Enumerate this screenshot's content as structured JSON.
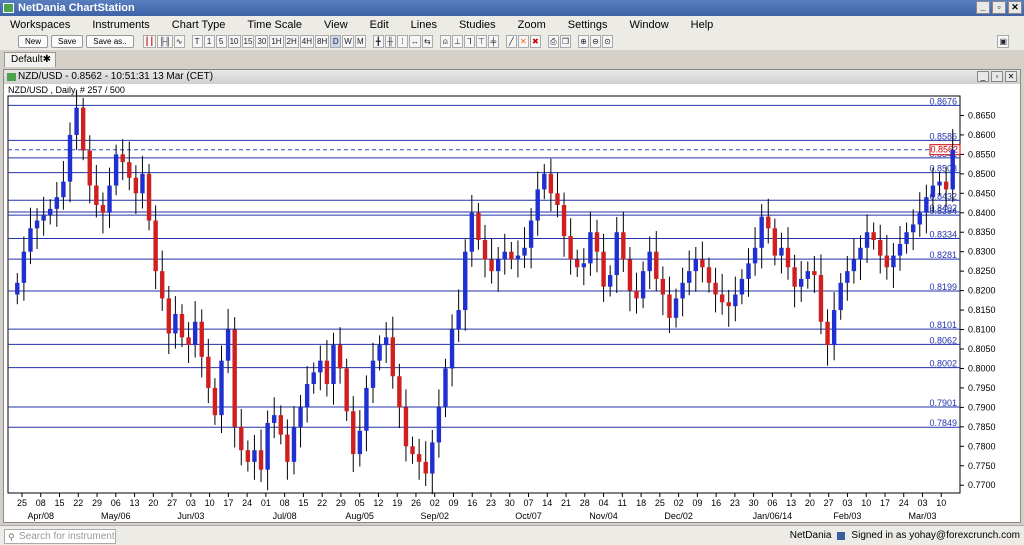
{
  "window": {
    "title": "NetDania ChartStation",
    "buttons": [
      "_",
      "▫",
      "✕"
    ]
  },
  "menu": [
    "Workspaces",
    "Instruments",
    "Chart Type",
    "Time Scale",
    "View",
    "Edit",
    "Lines",
    "Studies",
    "Zoom",
    "Settings",
    "Window",
    "Help"
  ],
  "toolbar": {
    "new": "New",
    "save": "Save",
    "save_as": "Save as..",
    "periods": [
      "T",
      "1",
      "5",
      "10",
      "15",
      "30",
      "1H",
      "2H",
      "4H",
      "8H",
      "D",
      "W",
      "M"
    ]
  },
  "tab": {
    "label": "Default",
    "close": "✱"
  },
  "chart_window": {
    "title": "NZD/USD - 0.8562 - 10:51:31  13 Mar (CET)",
    "subtitle": "NZD/USD , Daily, # 257 / 500"
  },
  "chart_data": {
    "type": "candlestick",
    "ylim": [
      0.768,
      0.87
    ],
    "y_ticks": [
      "0.8650",
      "0.8600",
      "0.8550",
      "0.8500",
      "0.8450",
      "0.8400",
      "0.8350",
      "0.8300",
      "0.8250",
      "0.8200",
      "0.8150",
      "0.8100",
      "0.8050",
      "0.8000",
      "0.7950",
      "0.7900",
      "0.7850",
      "0.7800",
      "0.7750",
      "0.7700"
    ],
    "x_ticks": [
      "25",
      "08",
      "15",
      "22",
      "29",
      "06",
      "13",
      "20",
      "27",
      "03",
      "10",
      "17",
      "24",
      "01",
      "08",
      "15",
      "22",
      "29",
      "05",
      "12",
      "19",
      "26",
      "02",
      "09",
      "16",
      "23",
      "30",
      "07",
      "14",
      "21",
      "28",
      "04",
      "11",
      "18",
      "25",
      "02",
      "09",
      "16",
      "23",
      "30",
      "06",
      "13",
      "20",
      "27",
      "03",
      "10",
      "17",
      "24",
      "03",
      "10"
    ],
    "month_labels": [
      {
        "label": "Apr/08",
        "at": 1
      },
      {
        "label": "May/06",
        "at": 5
      },
      {
        "label": "Jun/03",
        "at": 9
      },
      {
        "label": "Jul/08",
        "at": 14
      },
      {
        "label": "Aug/05",
        "at": 18
      },
      {
        "label": "Sep/02",
        "at": 22
      },
      {
        "label": "Oct/07",
        "at": 27
      },
      {
        "label": "Nov/04",
        "at": 31
      },
      {
        "label": "Dec/02",
        "at": 35
      },
      {
        "label": "Jan/06/14",
        "at": 40
      },
      {
        "label": "Feb/03",
        "at": 44
      },
      {
        "label": "Mar/03",
        "at": 48
      }
    ],
    "h_lines": [
      {
        "value": 0.8676,
        "label": "0.8676"
      },
      {
        "value": 0.8586,
        "label": "0.8586"
      },
      {
        "value": 0.8541,
        "label": "0.8541"
      },
      {
        "value": 0.8503,
        "label": "0.8503"
      },
      {
        "value": 0.8432,
        "label": "0.8432"
      },
      {
        "value": 0.8402,
        "label": "0.8402"
      },
      {
        "value": 0.8394,
        "label": "0.8394"
      },
      {
        "value": 0.8334,
        "label": "0.8334"
      },
      {
        "value": 0.8281,
        "label": "0.8281"
      },
      {
        "value": 0.8199,
        "label": "0.8199"
      },
      {
        "value": 0.8101,
        "label": "0.8101"
      },
      {
        "value": 0.8062,
        "label": "0.8062"
      },
      {
        "value": 0.8002,
        "label": "0.8002"
      },
      {
        "value": 0.7901,
        "label": "0.7901"
      },
      {
        "value": 0.7849,
        "label": "0.7849"
      }
    ],
    "current": {
      "value": 0.8562,
      "label": "0.8562"
    },
    "closes": [
      0.822,
      0.83,
      0.836,
      0.838,
      0.8395,
      0.841,
      0.844,
      0.848,
      0.86,
      0.867,
      0.856,
      0.847,
      0.842,
      0.84,
      0.847,
      0.855,
      0.853,
      0.849,
      0.845,
      0.85,
      0.838,
      0.825,
      0.818,
      0.809,
      0.814,
      0.808,
      0.806,
      0.812,
      0.803,
      0.795,
      0.788,
      0.802,
      0.81,
      0.785,
      0.779,
      0.776,
      0.779,
      0.774,
      0.786,
      0.788,
      0.783,
      0.776,
      0.785,
      0.79,
      0.796,
      0.799,
      0.802,
      0.796,
      0.806,
      0.8,
      0.789,
      0.778,
      0.784,
      0.795,
      0.802,
      0.806,
      0.808,
      0.798,
      0.79,
      0.78,
      0.778,
      0.776,
      0.773,
      0.781,
      0.79,
      0.8,
      0.81,
      0.815,
      0.83,
      0.84,
      0.833,
      0.828,
      0.825,
      0.828,
      0.83,
      0.828,
      0.829,
      0.831,
      0.838,
      0.846,
      0.85,
      0.845,
      0.842,
      0.834,
      0.828,
      0.826,
      0.827,
      0.835,
      0.83,
      0.821,
      0.824,
      0.835,
      0.828,
      0.82,
      0.818,
      0.825,
      0.83,
      0.823,
      0.819,
      0.813,
      0.818,
      0.822,
      0.825,
      0.828,
      0.826,
      0.822,
      0.819,
      0.817,
      0.816,
      0.819,
      0.823,
      0.827,
      0.831,
      0.839,
      0.836,
      0.829,
      0.831,
      0.826,
      0.821,
      0.823,
      0.825,
      0.824,
      0.812,
      0.806,
      0.815,
      0.822,
      0.825,
      0.828,
      0.831,
      0.835,
      0.833,
      0.829,
      0.826,
      0.829,
      0.832,
      0.835,
      0.837,
      0.84,
      0.844,
      0.847,
      0.848,
      0.846,
      0.8562
    ]
  },
  "status": {
    "search_placeholder": "Search for instrument",
    "brand": "NetDania",
    "signed": "Signed in as yohay@forexcrunch.com"
  }
}
